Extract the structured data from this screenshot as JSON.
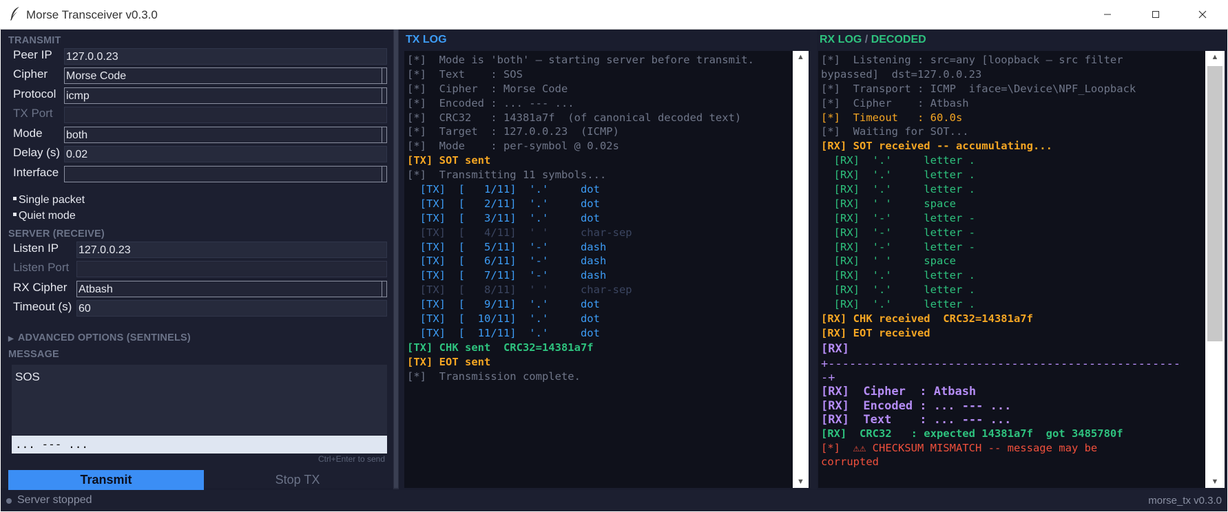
{
  "window": {
    "title": "Morse Transceiver  v0.3.0",
    "controls": [
      "minimize-icon",
      "maximize-icon",
      "close-icon"
    ]
  },
  "transmit": {
    "section": "TRANSMIT",
    "peer_ip_label": "Peer IP",
    "peer_ip": "127.0.0.23",
    "cipher_label": "Cipher",
    "cipher": "Morse Code",
    "protocol_label": "Protocol",
    "protocol": "icmp",
    "tx_port_label": "TX Port",
    "tx_port": "",
    "mode_label": "Mode",
    "mode": "both",
    "delay_label": "Delay (s)",
    "delay": "0.02",
    "interface_label": "Interface",
    "interface": "",
    "single_packet": "Single packet",
    "quiet_mode": "Quiet mode"
  },
  "server": {
    "section": "SERVER  (RECEIVE)",
    "listen_ip_label": "Listen IP",
    "listen_ip": "127.0.0.23",
    "listen_port_label": "Listen Port",
    "listen_port": "",
    "rx_cipher_label": "RX Cipher",
    "rx_cipher": "Atbash",
    "timeout_label": "Timeout (s)",
    "timeout": "60"
  },
  "advanced": {
    "label": "ADVANCED OPTIONS  (SENTINELS)",
    "icon": "triangle-right-icon"
  },
  "message": {
    "section": "MESSAGE",
    "text": "SOS",
    "encoded": "... --- ...",
    "hint": "Ctrl+Enter to send"
  },
  "buttons": {
    "transmit": "Transmit",
    "stop": "Stop TX"
  },
  "tx_log": {
    "title": "TX LOG",
    "lines": [
      {
        "t": "[*]  Mode is 'both' — starting server before transmit.",
        "c": "gray"
      },
      {
        "t": "[*]  Text    : SOS",
        "c": "gray"
      },
      {
        "t": "[*]  Cipher  : Morse Code",
        "c": "gray"
      },
      {
        "t": "[*]  Encoded : ... --- ...",
        "c": "gray"
      },
      {
        "t": "[*]  CRC32   : 14381a7f  (of canonical decoded text)",
        "c": "gray"
      },
      {
        "t": "[*]  Target  : 127.0.0.23  (ICMP)",
        "c": "gray"
      },
      {
        "t": "[*]  Mode    : per-symbol @ 0.02s",
        "c": "gray"
      },
      {
        "t": "[TX] SOT sent",
        "c": "orange"
      },
      {
        "t": "[*]  Transmitting 11 symbols...",
        "c": "gray"
      },
      {
        "t": "  [TX]  [   1/11]  '.'     dot",
        "c": "blue"
      },
      {
        "t": "  [TX]  [   2/11]  '.'     dot",
        "c": "blue"
      },
      {
        "t": "  [TX]  [   3/11]  '.'     dot",
        "c": "blue"
      },
      {
        "t": "  [TX]  [   4/11]  ' '     char-sep",
        "c": "dim"
      },
      {
        "t": "  [TX]  [   5/11]  '-'     dash",
        "c": "blue"
      },
      {
        "t": "  [TX]  [   6/11]  '-'     dash",
        "c": "blue"
      },
      {
        "t": "  [TX]  [   7/11]  '-'     dash",
        "c": "blue"
      },
      {
        "t": "  [TX]  [   8/11]  ' '     char-sep",
        "c": "dim"
      },
      {
        "t": "  [TX]  [   9/11]  '.'     dot",
        "c": "blue"
      },
      {
        "t": "  [TX]  [  10/11]  '.'     dot",
        "c": "blue"
      },
      {
        "t": "  [TX]  [  11/11]  '.'     dot",
        "c": "blue"
      },
      {
        "t": "[TX] CHK sent  CRC32=14381a7f",
        "c": "greenb"
      },
      {
        "t": "[TX] EOT sent",
        "c": "orange"
      },
      {
        "t": "[*]  Transmission complete.",
        "c": "gray"
      }
    ]
  },
  "rx_log": {
    "title_a": "RX LOG",
    "title_sep": " / ",
    "title_b": "DECODED",
    "lines": [
      {
        "t": "[*]  Listening : src=any [loopback — src filter",
        "c": "gray"
      },
      {
        "t": "bypassed]  dst=127.0.0.23",
        "c": "gray"
      },
      {
        "t": "[*]  Transport : ICMP  iface=\\Device\\NPF_Loopback",
        "c": "gray"
      },
      {
        "t": "[*]  Cipher    : Atbash",
        "c": "gray"
      },
      {
        "t": "[*]  Timeout   : 60.0s",
        "c": "orange-n"
      },
      {
        "t": "[*]  Waiting for SOT...",
        "c": "gray"
      },
      {
        "t": "[RX] SOT received -- accumulating...",
        "c": "orange"
      },
      {
        "t": "  [RX]  '.'     letter .",
        "c": "green"
      },
      {
        "t": "  [RX]  '.'     letter .",
        "c": "green"
      },
      {
        "t": "  [RX]  '.'     letter .",
        "c": "green"
      },
      {
        "t": "  [RX]  ' '     space",
        "c": "green"
      },
      {
        "t": "  [RX]  '-'     letter -",
        "c": "green"
      },
      {
        "t": "  [RX]  '-'     letter -",
        "c": "green"
      },
      {
        "t": "  [RX]  '-'     letter -",
        "c": "green"
      },
      {
        "t": "  [RX]  ' '     space",
        "c": "green"
      },
      {
        "t": "  [RX]  '.'     letter .",
        "c": "green"
      },
      {
        "t": "  [RX]  '.'     letter .",
        "c": "green"
      },
      {
        "t": "  [RX]  '.'     letter .",
        "c": "green"
      },
      {
        "t": "[RX] CHK received  CRC32=14381a7f",
        "c": "orange"
      },
      {
        "t": "[RX] EOT received",
        "c": "orange"
      }
    ],
    "decoded_lines": [
      {
        "t": "[RX]",
        "c": "purple"
      },
      {
        "t": "+--------------------------------------------------",
        "c": "purple-n"
      },
      {
        "t": "-+",
        "c": "purple-n"
      },
      {
        "t": "[RX]  Cipher  : Atbash",
        "c": "purple"
      },
      {
        "t": "[RX]  Encoded : ... --- ...",
        "c": "purple"
      },
      {
        "t": "[RX]  Text    : ... --- ...",
        "c": "purple"
      },
      {
        "t": "[RX]  CRC32   : expected 14381a7f  got 3485780f",
        "c": "greenb"
      },
      {
        "t": "[*]  ⚠⚠ CHECKSUM MISMATCH -- message may be",
        "c": "red"
      },
      {
        "t": "corrupted",
        "c": "red"
      }
    ]
  },
  "status": {
    "text": "Server stopped",
    "version": "morse_tx v0.3.0"
  },
  "colors": {
    "accent": "#3b8ef5",
    "orange": "#f5a623",
    "blue": "#3d9cf5",
    "green": "#2ec27e",
    "purple": "#b58cf5",
    "red": "#f0503c",
    "background": "#1a1d2e",
    "log_background": "#0f111b"
  }
}
